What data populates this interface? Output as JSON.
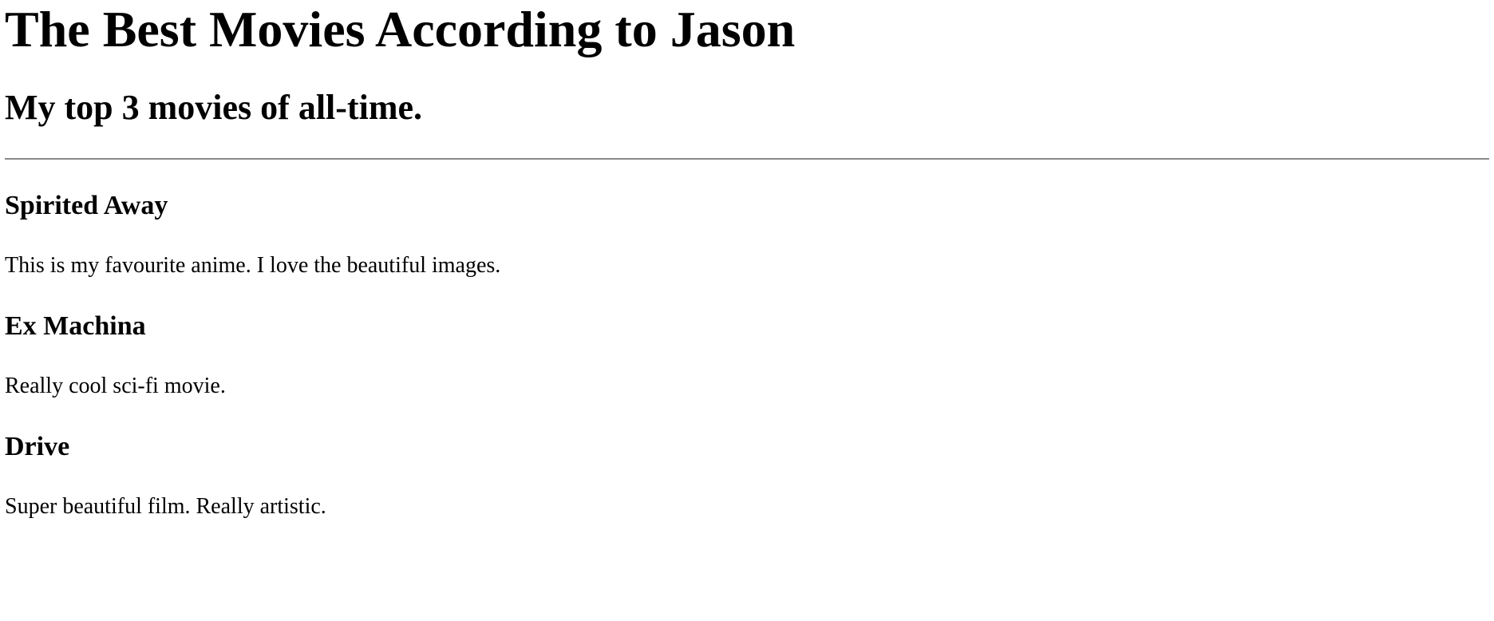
{
  "header": {
    "title": "The Best Movies According to Jason",
    "subtitle": "My top 3 movies of all-time."
  },
  "movies": [
    {
      "title": "Spirited Away",
      "description": "This is my favourite anime. I love the beautiful images."
    },
    {
      "title": "Ex Machina",
      "description": "Really cool sci-fi movie."
    },
    {
      "title": "Drive",
      "description": "Super beautiful film. Really artistic."
    }
  ]
}
